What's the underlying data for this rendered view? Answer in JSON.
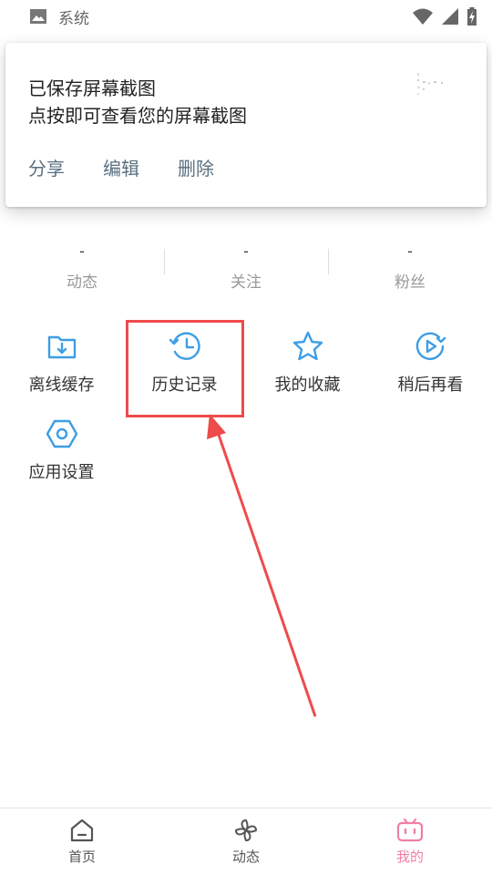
{
  "status_bar": {
    "app_label": "系统",
    "icons": [
      "image-icon",
      "wifi-icon",
      "signal-icon",
      "battery-icon"
    ]
  },
  "notification": {
    "line1": "已保存屏幕截图",
    "line2": "点按即可查看您的屏幕截图",
    "actions": [
      "分享",
      "编辑",
      "删除"
    ]
  },
  "stats": [
    {
      "value": "-",
      "label": "动态"
    },
    {
      "value": "-",
      "label": "关注"
    },
    {
      "value": "-",
      "label": "粉丝"
    }
  ],
  "menu": [
    {
      "label": "离线缓存",
      "icon": "folder-download-icon"
    },
    {
      "label": "历史记录",
      "icon": "history-clock-icon"
    },
    {
      "label": "我的收藏",
      "icon": "star-icon"
    },
    {
      "label": "稍后再看",
      "icon": "play-later-icon"
    },
    {
      "label": "应用设置",
      "icon": "settings-hexagon-icon"
    }
  ],
  "bottom_nav": [
    {
      "label": "首页",
      "icon": "home-icon",
      "active": false
    },
    {
      "label": "动态",
      "icon": "pinwheel-icon",
      "active": false
    },
    {
      "label": "我的",
      "icon": "tv-icon",
      "active": true
    }
  ],
  "colors": {
    "accent_blue": "#3d9ee4",
    "active_pink": "#f07fa4",
    "highlight_red": "#ee4b4b",
    "action_gray": "#5a6f7f"
  }
}
